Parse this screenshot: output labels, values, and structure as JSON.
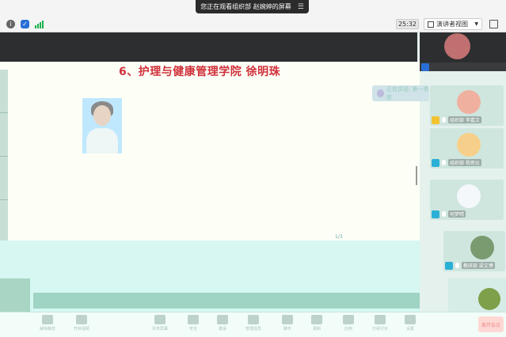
{
  "banner": {
    "text": "您正在观看组织部 赵婉婷的屏幕",
    "menu_icon": "menu-icon"
  },
  "status": {
    "timer": "25:32",
    "view_mode": "演讲者视图"
  },
  "slide": {
    "title": "6、护理与健康管理学院 徐明珠",
    "subtitle_hint": "",
    "page_hint": "1/3"
  },
  "meeting_chip": {
    "text": "正在讲话: 第一季度"
  },
  "participants": [
    {
      "name": "",
      "color": "#2a6fd6"
    },
    {
      "name": "组织部 李嘉文",
      "color": "#f2c230"
    },
    {
      "name": "组织部 杨思仪",
      "color": "#2ab0d6"
    },
    {
      "name": "何梦晴",
      "color": "#2ab0d6"
    },
    {
      "name": "教研部 梁文博",
      "color": "#2ab0d6"
    }
  ],
  "toolbar": {
    "items": [
      {
        "label": "解除静音",
        "icon": "mic-icon"
      },
      {
        "label": "开启视频",
        "icon": "camera-icon"
      },
      {
        "label": "共享屏幕",
        "icon": "share-icon"
      },
      {
        "label": "安全",
        "icon": "shield-icon"
      },
      {
        "label": "邀请",
        "icon": "invite-icon"
      },
      {
        "label": "管理成员",
        "icon": "members-icon"
      },
      {
        "label": "聊天",
        "icon": "chat-icon"
      },
      {
        "label": "录制",
        "icon": "record-icon"
      },
      {
        "label": "应用",
        "icon": "apps-icon"
      },
      {
        "label": "分组讨论",
        "icon": "breakout-icon"
      },
      {
        "label": "设置",
        "icon": "gear-icon"
      }
    ],
    "leave": "离开会议"
  }
}
